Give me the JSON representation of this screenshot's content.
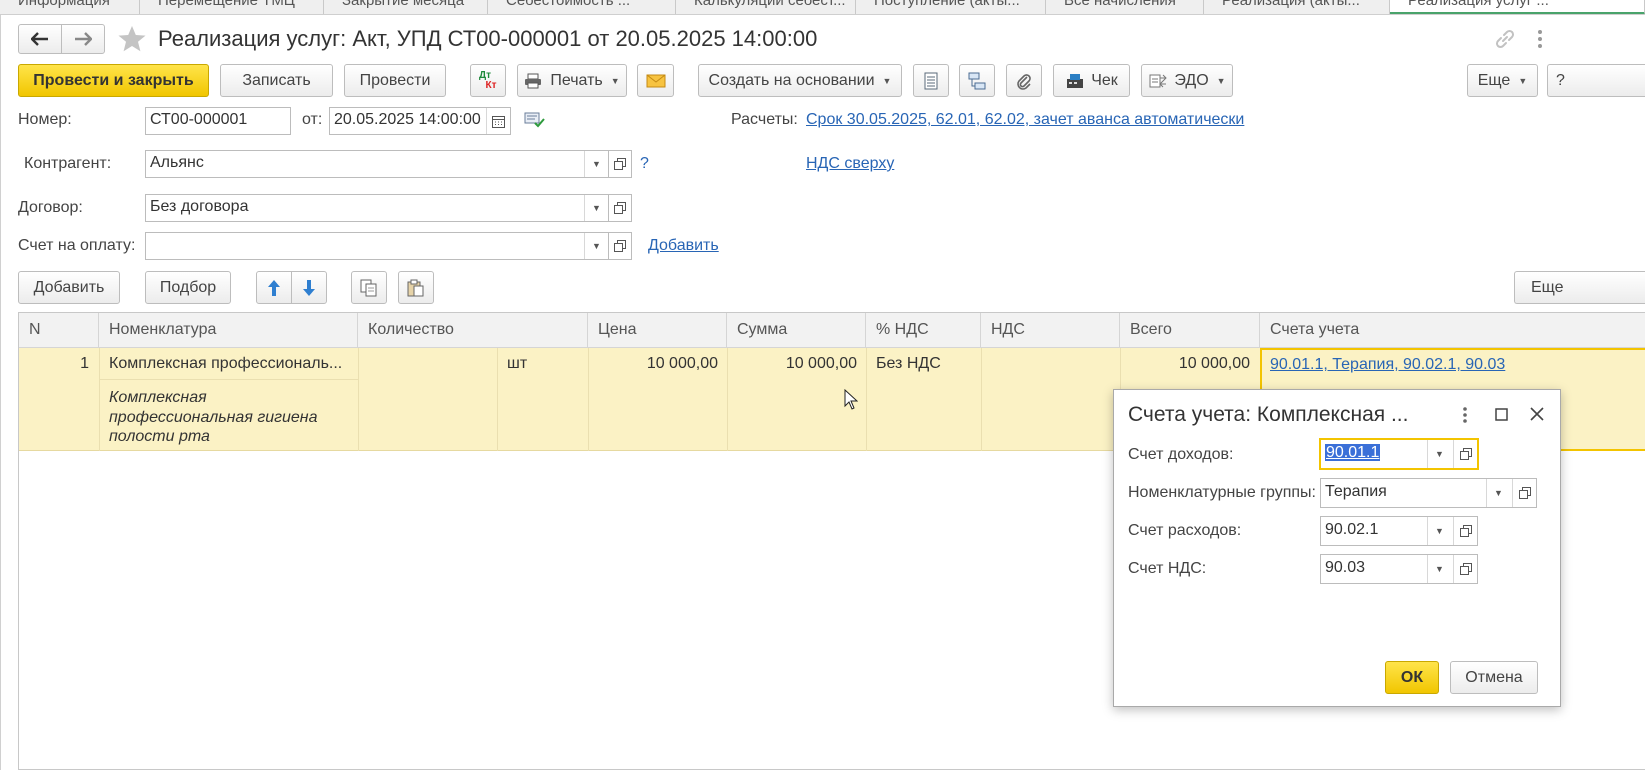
{
  "tabs": [
    "Информация",
    "Перемещение ТМЦ",
    "Закрытие месяца",
    "Себестоимость ...",
    "Калькуляции себест...",
    "Поступление (акты...",
    "Все начисления",
    "Реализация (акты...",
    "Реализация услуг ..."
  ],
  "document": {
    "title": "Реализация услуг: Акт, УПД СТ00-000001 от 20.05.2025 14:00:00"
  },
  "toolbar": {
    "post_and_close": "Провести и закрыть",
    "save": "Записать",
    "post": "Провести",
    "dt_kt_top": "Дт",
    "dt_kt_bottom": "Кт",
    "print": "Печать",
    "create_based_on": "Создать на основании",
    "check": "Чек",
    "edo": "ЭДО",
    "more": "Еще"
  },
  "form": {
    "number_label": "Номер:",
    "number_value": "СТ00-000001",
    "date_label": "от:",
    "date_value": "20.05.2025 14:00:00",
    "settlements_label": "Расчеты:",
    "settlements_link": "Срок 30.05.2025, 62.01, 62.02, зачет аванса автоматически",
    "counterparty_label": "Контрагент:",
    "counterparty_value": "Альянс",
    "question_mark": "?",
    "vat_link": "НДС сверху",
    "contract_label": "Договор:",
    "contract_value": "Без договора",
    "invoice_label": "Счет на оплату:",
    "invoice_value": "",
    "invoice_add_link": "Добавить"
  },
  "table_toolbar": {
    "add": "Добавить",
    "pick": "Подбор",
    "more": "Еще"
  },
  "table": {
    "columns": [
      "N",
      "Номенклатура",
      "Количество",
      "Цена",
      "Сумма",
      "% НДС",
      "НДС",
      "Всего",
      "Счета учета"
    ],
    "rows": [
      {
        "n": "1",
        "nomenclature": "Комплексная профессиональ...",
        "description_lines": [
          "Комплексная",
          "профессиональная гигиена",
          "полости рта"
        ],
        "quantity": "",
        "unit": "шт",
        "price": "10 000,00",
        "sum": "10 000,00",
        "vat_rate": "Без НДС",
        "vat": "",
        "total": "10 000,00",
        "accounts": "90.01.1, Терапия, 90.02.1, 90.03"
      }
    ]
  },
  "dialog": {
    "title": "Счета учета: Комплексная ...",
    "income_account_label": "Счет доходов:",
    "income_account_value": "90.01.1",
    "nomenclature_group_label": "Номенклатурные группы:",
    "nomenclature_group_value": "Терапия",
    "expense_account_label": "Счет расходов:",
    "expense_account_value": "90.02.1",
    "vat_account_label": "Счет НДС:",
    "vat_account_value": "90.03",
    "ok": "ОК",
    "cancel": "Отмена"
  },
  "colors": {
    "accent_yellow": "#f5cf10",
    "row_highlight": "#fbf2c5",
    "link": "#2865b5",
    "selection": "#3a6fd8"
  }
}
